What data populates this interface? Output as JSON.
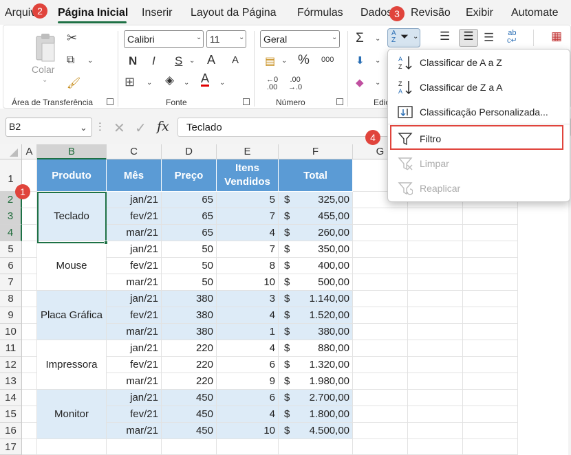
{
  "menu": {
    "tabs": [
      "Arquivo",
      "Página Inicial",
      "Inserir",
      "Layout da Página",
      "Fórmulas",
      "Dados",
      "Revisão",
      "Exibir",
      "Automate"
    ],
    "active": "Página Inicial"
  },
  "badges": [
    "1",
    "2",
    "3",
    "4"
  ],
  "ribbon": {
    "paste_label": "Colar",
    "clipboard_label": "Área de Transferência",
    "font_name": "Calibri",
    "font_size": "11",
    "font_label": "Fonte",
    "number_format": "Geral",
    "number_label": "Número",
    "editing_label": "Edição",
    "bold": "N",
    "italic": "I",
    "underline": "S",
    "grow_font": "A",
    "shrink_font": "A",
    "percent": "%",
    "thousands": "000",
    "sigma": "Σ"
  },
  "formula_bar": {
    "name_box": "B2",
    "fx": "fx",
    "content": "Teclado"
  },
  "sheet": {
    "columns": [
      "A",
      "B",
      "C",
      "D",
      "E",
      "F",
      "G"
    ],
    "rows": [
      "1",
      "2",
      "3",
      "4",
      "5",
      "6",
      "7",
      "8",
      "9",
      "10",
      "11",
      "12",
      "13",
      "14",
      "15",
      "16",
      "17"
    ],
    "headers": {
      "produto": "Produto",
      "mes": "Mês",
      "preco": "Preço",
      "itens1": "Itens",
      "itens2": "Vendidos",
      "total": "Total"
    },
    "products": [
      "Teclado",
      "Mouse",
      "Placa Gráfica",
      "Impressora",
      "Monitor"
    ],
    "currency": "$",
    "data": [
      {
        "mes": "jan/21",
        "preco": "65",
        "itens": "5",
        "total": "325,00"
      },
      {
        "mes": "fev/21",
        "preco": "65",
        "itens": "7",
        "total": "455,00"
      },
      {
        "mes": "mar/21",
        "preco": "65",
        "itens": "4",
        "total": "260,00"
      },
      {
        "mes": "jan/21",
        "preco": "50",
        "itens": "7",
        "total": "350,00"
      },
      {
        "mes": "fev/21",
        "preco": "50",
        "itens": "8",
        "total": "400,00"
      },
      {
        "mes": "mar/21",
        "preco": "50",
        "itens": "10",
        "total": "500,00"
      },
      {
        "mes": "jan/21",
        "preco": "380",
        "itens": "3",
        "total": "1.140,00"
      },
      {
        "mes": "fev/21",
        "preco": "380",
        "itens": "4",
        "total": "1.520,00"
      },
      {
        "mes": "mar/21",
        "preco": "380",
        "itens": "1",
        "total": "380,00"
      },
      {
        "mes": "jan/21",
        "preco": "220",
        "itens": "4",
        "total": "880,00"
      },
      {
        "mes": "fev/21",
        "preco": "220",
        "itens": "6",
        "total": "1.320,00"
      },
      {
        "mes": "mar/21",
        "preco": "220",
        "itens": "9",
        "total": "1.980,00"
      },
      {
        "mes": "jan/21",
        "preco": "450",
        "itens": "6",
        "total": "2.700,00"
      },
      {
        "mes": "fev/21",
        "preco": "450",
        "itens": "4",
        "total": "1.800,00"
      },
      {
        "mes": "mar/21",
        "preco": "450",
        "itens": "10",
        "total": "4.500,00"
      }
    ]
  },
  "dropdown": {
    "items": [
      {
        "label": "Classificar de A a Z",
        "enabled": true
      },
      {
        "label": "Classificar de Z a A",
        "enabled": true
      },
      {
        "label": "Classificação Personalizada...",
        "enabled": true
      },
      {
        "label": "Filtro",
        "enabled": true
      },
      {
        "label": "Limpar",
        "enabled": false
      },
      {
        "label": "Reaplicar",
        "enabled": false
      }
    ]
  },
  "colors": {
    "accent": "#1e7145",
    "header_blue": "#5b9bd5",
    "band_blue": "#ddebf7",
    "badge_red": "#e0443c",
    "highlight": "#e0443c"
  }
}
